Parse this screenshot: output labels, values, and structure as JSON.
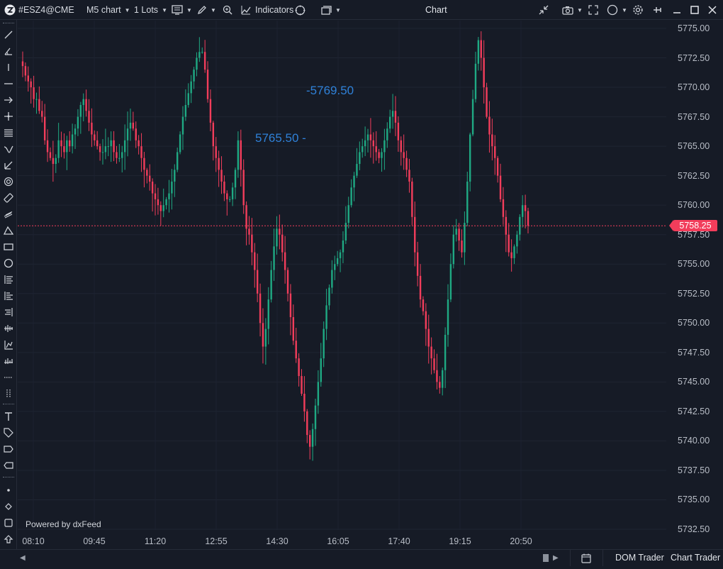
{
  "toolbar": {
    "symbol": "#ESZ4@CME",
    "timeframe": "M5 chart",
    "lots": "1 Lots",
    "indicators_label": "Indicators",
    "title": "Chart"
  },
  "chart_data": {
    "type": "candlestick",
    "y_axis_labels": [
      "5775.00",
      "5772.50",
      "5770.00",
      "5767.50",
      "5765.00",
      "5762.50",
      "5760.00",
      "5757.50",
      "5755.00",
      "5752.50",
      "5750.00",
      "5747.50",
      "5745.00",
      "5742.50",
      "5740.00",
      "5737.50",
      "5735.00",
      "5732.50"
    ],
    "x_axis_labels": [
      "08:10",
      "09:45",
      "11:20",
      "12:55",
      "14:30",
      "16:05",
      "17:40",
      "19:15",
      "20:50"
    ],
    "ylim": [
      5732.5,
      5775.0
    ],
    "current_price": "5758.25",
    "annotations": [
      "-5769.50",
      "5765.50 -"
    ],
    "candle_closes": [
      5771.8,
      5771,
      5770.5,
      5770,
      5769,
      5769,
      5768,
      5767.5,
      5765.5,
      5764.5,
      5764,
      5763.5,
      5764,
      5765.5,
      5765,
      5764.5,
      5765.5,
      5765,
      5766,
      5766.5,
      5767.5,
      5768.5,
      5769,
      5768,
      5767,
      5766,
      5765.5,
      5765,
      5764.5,
      5764.5,
      5765,
      5765,
      5765.5,
      5764.5,
      5764,
      5764,
      5764.5,
      5765.5,
      5766.5,
      5767,
      5766.5,
      5765.5,
      5765,
      5764,
      5763,
      5762.5,
      5762,
      5761,
      5760.5,
      5760,
      5759.5,
      5760,
      5760.5,
      5761,
      5762,
      5763,
      5764.5,
      5766,
      5767.5,
      5768.5,
      5769.5,
      5770.5,
      5771.5,
      5772.5,
      5773,
      5773,
      5771.5,
      5769,
      5767,
      5765,
      5764,
      5763,
      5762,
      5761,
      5760.5,
      5760.5,
      5761.5,
      5763,
      5765.5,
      5763,
      5760,
      5758,
      5757.5,
      5756,
      5754.5,
      5752.5,
      5750,
      5748,
      5749.5,
      5752,
      5754.5,
      5756.5,
      5758,
      5757.5,
      5756,
      5754.5,
      5752.5,
      5750.5,
      5748.5,
      5747,
      5745.5,
      5744,
      5742.5,
      5740.5,
      5739.5,
      5741,
      5743,
      5745,
      5747,
      5749.5,
      5751.5,
      5753,
      5754.5,
      5755,
      5755.5,
      5756,
      5757,
      5758.5,
      5760,
      5761.5,
      5762.5,
      5763.5,
      5764.5,
      5765,
      5765.5,
      5766,
      5765.5,
      5765,
      5764.5,
      5764,
      5764.5,
      5765.5,
      5766.5,
      5767.5,
      5768,
      5767,
      5765.5,
      5764.5,
      5764,
      5763,
      5762,
      5759,
      5756,
      5754,
      5752,
      5751,
      5749.5,
      5748,
      5747,
      5746,
      5745,
      5744.5,
      5746,
      5749,
      5752,
      5755,
      5757.5,
      5758,
      5757,
      5756,
      5758.5,
      5762,
      5766,
      5769,
      5772,
      5774,
      5772.5,
      5770,
      5767.5,
      5766,
      5765,
      5764,
      5762.5,
      5760.5,
      5759,
      5757.5,
      5756,
      5755.5,
      5756.5,
      5757.5,
      5759,
      5760,
      5759.5,
      5758.25
    ]
  },
  "watermark": "Powered by dxFeed",
  "bottom": {
    "dom_trader": "DOM Trader",
    "chart_trader": "Chart Trader"
  },
  "colors": {
    "bull": "#1fa983",
    "bear": "#f23d5b",
    "accent_blue": "#2f81d8",
    "background": "#161b26"
  },
  "icons": [
    "app-logo-icon",
    "dropdown-caret-icon",
    "trade-panel-icon",
    "pencil-icon",
    "crosshair-zoom-icon",
    "indicators-icon",
    "compass-icon",
    "layout-icon",
    "compress-icon",
    "camera-icon",
    "expand-icon",
    "circle-toggle-icon",
    "settings-icon",
    "pin-icon",
    "minimize-icon",
    "maximize-icon",
    "close-icon",
    "calendar-icon"
  ]
}
